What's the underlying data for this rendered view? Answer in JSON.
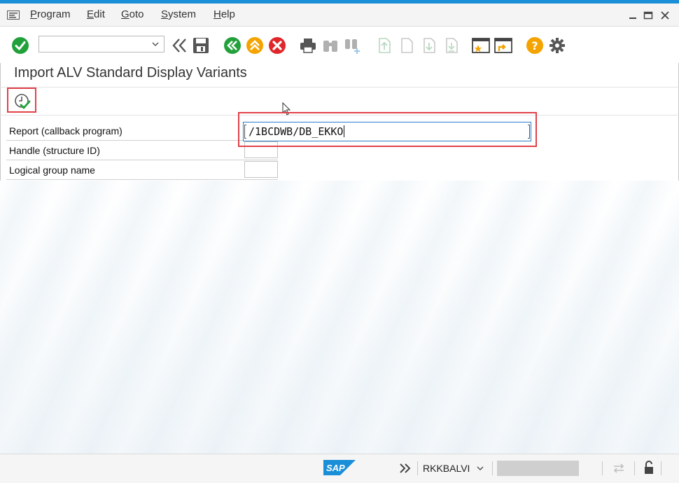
{
  "menu": {
    "items": [
      "Program",
      "Edit",
      "Goto",
      "System",
      "Help"
    ]
  },
  "toolbar": {
    "command_value": "",
    "icons": [
      "enter-icon",
      "command-dropdown",
      "back-double-chevron-icon",
      "save-icon",
      "back-icon",
      "exit-icon",
      "cancel-icon",
      "print-icon",
      "find-icon",
      "find-next-icon",
      "first-page-icon",
      "previous-page-icon",
      "next-page-icon",
      "last-page-icon",
      "create-session-icon",
      "shortcut-icon",
      "help-icon",
      "settings-icon"
    ]
  },
  "page": {
    "title": "Import ALV Standard Display Variants"
  },
  "form": {
    "fields": [
      {
        "label": "Report (callback program)",
        "value": "/1BCDWB/DB_EKKO"
      },
      {
        "label": "Handle (structure ID)",
        "value": ""
      },
      {
        "label": "Logical group name",
        "value": ""
      }
    ]
  },
  "status": {
    "logo": "SAP",
    "program": "RKKBALVI"
  },
  "colors": {
    "highlight": "#e0424a",
    "accent": "#1a8fd8",
    "green": "#22a13b",
    "orange": "#f4a300",
    "red": "#e0262a"
  }
}
